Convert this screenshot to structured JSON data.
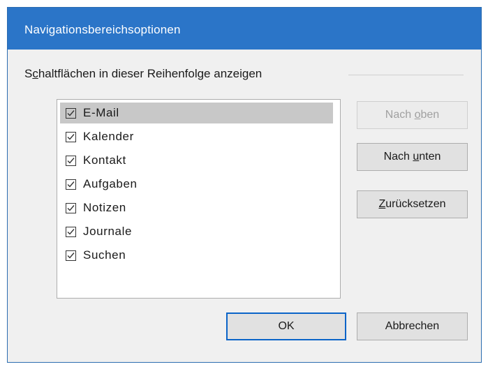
{
  "dialog": {
    "title": "Navigationsbereichsoptionen",
    "group_label_prefix": "S",
    "group_label_mnemonic": "c",
    "group_label_rest": "haltflächen in dieser Reihenfolge anzeigen",
    "items": [
      {
        "label": "E-Mail",
        "checked": true,
        "selected": true
      },
      {
        "label": "Kalender",
        "checked": true,
        "selected": false
      },
      {
        "label": "Kontakt",
        "checked": true,
        "selected": false
      },
      {
        "label": "Aufgaben",
        "checked": true,
        "selected": false
      },
      {
        "label": "Notizen",
        "checked": true,
        "selected": false
      },
      {
        "label": "Journale",
        "checked": true,
        "selected": false
      },
      {
        "label": "Suchen",
        "checked": true,
        "selected": false
      }
    ],
    "buttons": {
      "up_prefix": "Nach ",
      "up_mnemonic": "o",
      "up_rest": "ben",
      "down_prefix": "Nach ",
      "down_mnemonic": "u",
      "down_rest": "nten",
      "reset_prefix": "",
      "reset_mnemonic": "Z",
      "reset_rest": "urücksetzen",
      "ok_label": "OK",
      "cancel_label": "Abbrechen"
    }
  }
}
